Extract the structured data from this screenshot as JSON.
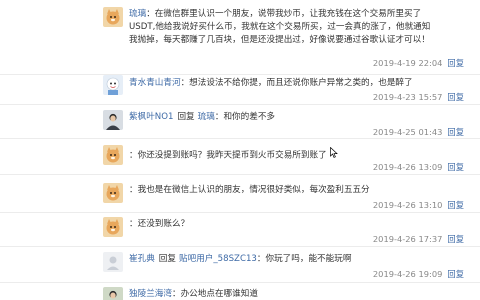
{
  "reply_label": "回复",
  "reply_prefix": "回复",
  "comments": [
    {
      "avatar": "cat-avatar",
      "user": "琉璃",
      "text_lines": [
        "：在微信群里认识一个朋友，说带我炒币，让我充钱在这个交易所里买了",
        "USDT,他给我说好买什么币，我就在这个交易所买，过一会真的涨了，他就通知",
        "我抛掉，每天都赚了几百块，但是还没提出过，好像说要通过谷歌认证才可以！"
      ],
      "time": "2019-4-19 22:04"
    },
    {
      "avatar": "cartoon-avatar",
      "user": "青水青山青河",
      "text": "：想法设法不给你提，而且还说你账户异常之类的，也是醉了",
      "time": "2019-4-23 15:57"
    },
    {
      "avatar": "person-avatar",
      "user": "紫枫叶NO1",
      "reply_to": "琉璃",
      "text": "：和你的差不多",
      "time": "2019-4-25 01:43"
    },
    {
      "avatar": "cat-avatar",
      "user": "",
      "text": "：你还没提到账吗？我昨天提币到火币交易所到账了",
      "time": "2019-4-26 13:09"
    },
    {
      "avatar": "cat-avatar",
      "user": "",
      "text_lines": [
        "：我也是在微信上认识的朋友，情况很好类似，每次盈利五五分"
      ],
      "time": "2019-4-26 13:10"
    },
    {
      "avatar": "cat-avatar",
      "user": "",
      "text": "：还没到账么？",
      "time": "2019-4-26 17:37"
    },
    {
      "avatar": "blank-avatar",
      "user": "崔孔典",
      "reply_to": "贴吧用户_58SZC13",
      "text": "：你玩了吗，能不能玩啊",
      "time": "2019-4-26 19:09"
    },
    {
      "avatar": "person-avatar",
      "user": "独陵兰海湾",
      "text": "：办公地点在哪谁知道",
      "time": ""
    }
  ]
}
